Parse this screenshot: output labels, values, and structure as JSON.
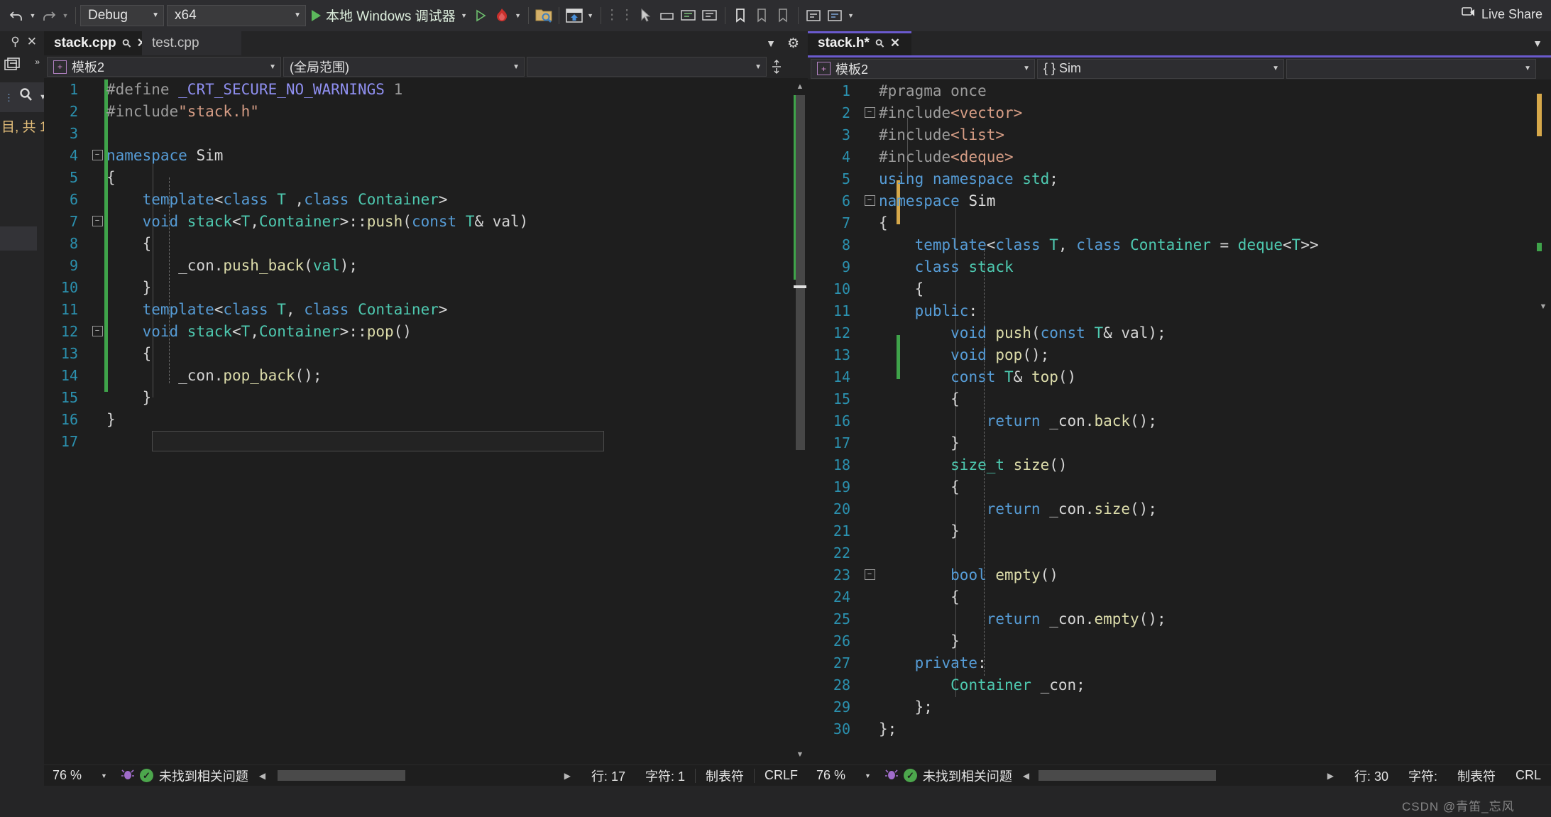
{
  "toolbar": {
    "undo_icon": "undo-icon",
    "redo_icon": "redo-icon",
    "config_value": "Debug",
    "platform_value": "x64",
    "run_label": "本地 Windows 调试器",
    "icons": [
      "folder-search-icon",
      "window-home-icon",
      "bookmark-icon",
      "bookmark-prev-icon",
      "bookmark-next-icon",
      "comment-icon",
      "uncomment-icon"
    ],
    "live_share_label": "Live Share"
  },
  "left_dock": {
    "pin_icon": "pin-icon",
    "close_icon": "close-icon",
    "window_icon": "window-restore-icon",
    "search_icon": "search-icon",
    "truncated_label": "目, 共 1"
  },
  "left_pane": {
    "tabs": [
      {
        "label": "stack.cpp",
        "active": true,
        "pin_icon": "pin-icon",
        "close_icon": "close-icon"
      },
      {
        "label": "test.cpp",
        "active": false,
        "pin_icon": "pin-icon",
        "close_icon": "close-icon"
      }
    ],
    "tabstrip_overflow_icon": "chevron-down-icon",
    "tabstrip_settings_icon": "gear-icon",
    "nav_project": "模板2",
    "nav_scope": "(全局范围)",
    "nav_member": "",
    "splitter_icon": "split-vertical-icon",
    "lines": [
      {
        "n": "1",
        "tokens": [
          {
            "t": "#define ",
            "c": "k-grey"
          },
          {
            "t": "_CRT_SECURE_NO_WARNINGS",
            "c": "k-purple"
          },
          {
            "t": " 1",
            "c": "k-grey"
          }
        ]
      },
      {
        "n": "2",
        "tokens": [
          {
            "t": "#include",
            "c": "k-grey"
          },
          {
            "t": "\"stack.h\"",
            "c": "k-orange"
          }
        ]
      },
      {
        "n": "3",
        "tokens": []
      },
      {
        "n": "4",
        "tokens": [
          {
            "t": "namespace ",
            "c": "k-blue"
          },
          {
            "t": "Sim",
            "c": "k-white"
          }
        ]
      },
      {
        "n": "5",
        "tokens": [
          {
            "t": "{",
            "c": "k-plain"
          }
        ]
      },
      {
        "n": "6",
        "tokens": [
          {
            "t": "    ",
            "c": "k-plain"
          },
          {
            "t": "template",
            "c": "k-blue"
          },
          {
            "t": "<",
            "c": "k-plain"
          },
          {
            "t": "class ",
            "c": "k-blue"
          },
          {
            "t": "T",
            "c": "k-cyan"
          },
          {
            "t": " ,",
            "c": "k-plain"
          },
          {
            "t": "class ",
            "c": "k-blue"
          },
          {
            "t": "Container",
            "c": "k-cyan"
          },
          {
            "t": ">",
            "c": "k-plain"
          }
        ]
      },
      {
        "n": "7",
        "tokens": [
          {
            "t": "    ",
            "c": "k-plain"
          },
          {
            "t": "void ",
            "c": "k-blue"
          },
          {
            "t": "stack",
            "c": "k-cyan"
          },
          {
            "t": "<",
            "c": "k-plain"
          },
          {
            "t": "T",
            "c": "k-cyan"
          },
          {
            "t": ",",
            "c": "k-plain"
          },
          {
            "t": "Container",
            "c": "k-cyan"
          },
          {
            "t": ">::",
            "c": "k-plain"
          },
          {
            "t": "push",
            "c": "k-yellow"
          },
          {
            "t": "(",
            "c": "k-plain"
          },
          {
            "t": "const ",
            "c": "k-blue"
          },
          {
            "t": "T",
            "c": "k-cyan"
          },
          {
            "t": "& val)",
            "c": "k-plain"
          }
        ]
      },
      {
        "n": "8",
        "tokens": [
          {
            "t": "    {",
            "c": "k-plain"
          }
        ]
      },
      {
        "n": "9",
        "tokens": [
          {
            "t": "        _con.",
            "c": "k-plain"
          },
          {
            "t": "push_back",
            "c": "k-yellow"
          },
          {
            "t": "(",
            "c": "k-plain"
          },
          {
            "t": "val",
            "c": "k-cyan"
          },
          {
            "t": ");",
            "c": "k-plain"
          }
        ]
      },
      {
        "n": "10",
        "tokens": [
          {
            "t": "    }",
            "c": "k-plain"
          }
        ]
      },
      {
        "n": "11",
        "tokens": [
          {
            "t": "    ",
            "c": "k-plain"
          },
          {
            "t": "template",
            "c": "k-blue"
          },
          {
            "t": "<",
            "c": "k-plain"
          },
          {
            "t": "class ",
            "c": "k-blue"
          },
          {
            "t": "T",
            "c": "k-cyan"
          },
          {
            "t": ", ",
            "c": "k-plain"
          },
          {
            "t": "class ",
            "c": "k-blue"
          },
          {
            "t": "Container",
            "c": "k-cyan"
          },
          {
            "t": ">",
            "c": "k-plain"
          }
        ]
      },
      {
        "n": "12",
        "tokens": [
          {
            "t": "    ",
            "c": "k-plain"
          },
          {
            "t": "void ",
            "c": "k-blue"
          },
          {
            "t": "stack",
            "c": "k-cyan"
          },
          {
            "t": "<",
            "c": "k-plain"
          },
          {
            "t": "T",
            "c": "k-cyan"
          },
          {
            "t": ",",
            "c": "k-plain"
          },
          {
            "t": "Container",
            "c": "k-cyan"
          },
          {
            "t": ">::",
            "c": "k-plain"
          },
          {
            "t": "pop",
            "c": "k-yellow"
          },
          {
            "t": "()",
            "c": "k-plain"
          }
        ]
      },
      {
        "n": "13",
        "tokens": [
          {
            "t": "    {",
            "c": "k-plain"
          }
        ]
      },
      {
        "n": "14",
        "tokens": [
          {
            "t": "        _con.",
            "c": "k-plain"
          },
          {
            "t": "pop_back",
            "c": "k-yellow"
          },
          {
            "t": "();",
            "c": "k-plain"
          }
        ]
      },
      {
        "n": "15",
        "tokens": [
          {
            "t": "    }",
            "c": "k-plain"
          }
        ]
      },
      {
        "n": "16",
        "tokens": [
          {
            "t": "}",
            "c": "k-plain"
          }
        ]
      },
      {
        "n": "17",
        "tokens": []
      }
    ],
    "status": {
      "zoom": "76 %",
      "zoom_caret_icon": "chevron-down-icon",
      "bug_icon": "bug-icon",
      "ok_icon": "check-icon",
      "issues": "未找到相关问题",
      "scroll_left_icon": "chevron-left-icon",
      "scroll_right_icon": "chevron-right-icon",
      "line": "行: 17",
      "column": "字符: 1",
      "indent": "制表符",
      "eol": "CRLF"
    }
  },
  "right_pane": {
    "tabs": [
      {
        "label": "stack.h*",
        "active": true,
        "pin_icon": "pin-icon",
        "close_icon": "close-icon",
        "accent": "#6a5acd"
      }
    ],
    "nav_project": "模板2",
    "nav_scope": "{ } Sim",
    "nav_member": "",
    "lines": [
      {
        "n": "1",
        "tokens": [
          {
            "t": "#pragma once",
            "c": "k-grey"
          }
        ]
      },
      {
        "n": "2",
        "tokens": [
          {
            "t": "#include",
            "c": "k-grey"
          },
          {
            "t": "<vector>",
            "c": "k-orange"
          }
        ]
      },
      {
        "n": "3",
        "tokens": [
          {
            "t": "#include",
            "c": "k-grey"
          },
          {
            "t": "<list>",
            "c": "k-orange"
          }
        ]
      },
      {
        "n": "4",
        "tokens": [
          {
            "t": "#include",
            "c": "k-grey"
          },
          {
            "t": "<deque>",
            "c": "k-orange"
          }
        ]
      },
      {
        "n": "5",
        "tokens": [
          {
            "t": "using namespace ",
            "c": "k-blue"
          },
          {
            "t": "std",
            "c": "k-cyan"
          },
          {
            "t": ";",
            "c": "k-plain"
          }
        ]
      },
      {
        "n": "6",
        "tokens": [
          {
            "t": "namespace ",
            "c": "k-blue"
          },
          {
            "t": "Sim",
            "c": "k-white"
          }
        ]
      },
      {
        "n": "7",
        "tokens": [
          {
            "t": "{",
            "c": "k-plain"
          }
        ]
      },
      {
        "n": "8",
        "tokens": [
          {
            "t": "    ",
            "c": "k-plain"
          },
          {
            "t": "template",
            "c": "k-blue"
          },
          {
            "t": "<",
            "c": "k-plain"
          },
          {
            "t": "class ",
            "c": "k-blue"
          },
          {
            "t": "T",
            "c": "k-cyan"
          },
          {
            "t": ", ",
            "c": "k-plain"
          },
          {
            "t": "class ",
            "c": "k-blue"
          },
          {
            "t": "Container",
            "c": "k-cyan"
          },
          {
            "t": " = ",
            "c": "k-plain"
          },
          {
            "t": "deque",
            "c": "k-cyan"
          },
          {
            "t": "<",
            "c": "k-plain"
          },
          {
            "t": "T",
            "c": "k-cyan"
          },
          {
            "t": ">>",
            "c": "k-plain"
          }
        ]
      },
      {
        "n": "9",
        "tokens": [
          {
            "t": "    ",
            "c": "k-plain"
          },
          {
            "t": "class ",
            "c": "k-blue"
          },
          {
            "t": "stack",
            "c": "k-cyan"
          }
        ]
      },
      {
        "n": "10",
        "tokens": [
          {
            "t": "    {",
            "c": "k-plain"
          }
        ]
      },
      {
        "n": "11",
        "tokens": [
          {
            "t": "    ",
            "c": "k-plain"
          },
          {
            "t": "public",
            "c": "k-blue"
          },
          {
            "t": ":",
            "c": "k-plain"
          }
        ]
      },
      {
        "n": "12",
        "tokens": [
          {
            "t": "        ",
            "c": "k-plain"
          },
          {
            "t": "void ",
            "c": "k-blue"
          },
          {
            "t": "push",
            "c": "k-yellow"
          },
          {
            "t": "(",
            "c": "k-plain"
          },
          {
            "t": "const ",
            "c": "k-blue"
          },
          {
            "t": "T",
            "c": "k-cyan"
          },
          {
            "t": "& val);",
            "c": "k-plain"
          }
        ]
      },
      {
        "n": "13",
        "tokens": [
          {
            "t": "        ",
            "c": "k-plain"
          },
          {
            "t": "void ",
            "c": "k-blue"
          },
          {
            "t": "pop",
            "c": "k-yellow"
          },
          {
            "t": "();",
            "c": "k-plain"
          }
        ]
      },
      {
        "n": "14",
        "tokens": [
          {
            "t": "        ",
            "c": "k-plain"
          },
          {
            "t": "const ",
            "c": "k-blue"
          },
          {
            "t": "T",
            "c": "k-cyan"
          },
          {
            "t": "& ",
            "c": "k-plain"
          },
          {
            "t": "top",
            "c": "k-yellow"
          },
          {
            "t": "()",
            "c": "k-plain"
          }
        ]
      },
      {
        "n": "15",
        "tokens": [
          {
            "t": "        {",
            "c": "k-plain"
          }
        ]
      },
      {
        "n": "16",
        "tokens": [
          {
            "t": "            ",
            "c": "k-plain"
          },
          {
            "t": "return ",
            "c": "k-blue"
          },
          {
            "t": "_con.",
            "c": "k-plain"
          },
          {
            "t": "back",
            "c": "k-yellow"
          },
          {
            "t": "();",
            "c": "k-plain"
          }
        ]
      },
      {
        "n": "17",
        "tokens": [
          {
            "t": "        }",
            "c": "k-plain"
          }
        ]
      },
      {
        "n": "18",
        "tokens": [
          {
            "t": "        ",
            "c": "k-plain"
          },
          {
            "t": "size_t ",
            "c": "k-cyan"
          },
          {
            "t": "size",
            "c": "k-yellow"
          },
          {
            "t": "()",
            "c": "k-plain"
          }
        ]
      },
      {
        "n": "19",
        "tokens": [
          {
            "t": "        {",
            "c": "k-plain"
          }
        ]
      },
      {
        "n": "20",
        "tokens": [
          {
            "t": "            ",
            "c": "k-plain"
          },
          {
            "t": "return ",
            "c": "k-blue"
          },
          {
            "t": "_con.",
            "c": "k-plain"
          },
          {
            "t": "size",
            "c": "k-yellow"
          },
          {
            "t": "();",
            "c": "k-plain"
          }
        ]
      },
      {
        "n": "21",
        "tokens": [
          {
            "t": "        }",
            "c": "k-plain"
          }
        ]
      },
      {
        "n": "22",
        "tokens": []
      },
      {
        "n": "23",
        "tokens": [
          {
            "t": "        ",
            "c": "k-plain"
          },
          {
            "t": "bool ",
            "c": "k-blue"
          },
          {
            "t": "empty",
            "c": "k-yellow"
          },
          {
            "t": "()",
            "c": "k-plain"
          }
        ]
      },
      {
        "n": "24",
        "tokens": [
          {
            "t": "        {",
            "c": "k-plain"
          }
        ]
      },
      {
        "n": "25",
        "tokens": [
          {
            "t": "            ",
            "c": "k-plain"
          },
          {
            "t": "return ",
            "c": "k-blue"
          },
          {
            "t": "_con.",
            "c": "k-plain"
          },
          {
            "t": "empty",
            "c": "k-yellow"
          },
          {
            "t": "();",
            "c": "k-plain"
          }
        ]
      },
      {
        "n": "26",
        "tokens": [
          {
            "t": "        }",
            "c": "k-plain"
          }
        ]
      },
      {
        "n": "27",
        "tokens": [
          {
            "t": "    ",
            "c": "k-plain"
          },
          {
            "t": "private",
            "c": "k-blue"
          },
          {
            "t": ":",
            "c": "k-plain"
          }
        ]
      },
      {
        "n": "28",
        "tokens": [
          {
            "t": "        ",
            "c": "k-plain"
          },
          {
            "t": "Container",
            "c": "k-cyan"
          },
          {
            "t": " _con;",
            "c": "k-plain"
          }
        ]
      },
      {
        "n": "29",
        "tokens": [
          {
            "t": "    };",
            "c": "k-plain"
          }
        ]
      },
      {
        "n": "30",
        "tokens": [
          {
            "t": "};",
            "c": "k-plain"
          }
        ]
      }
    ],
    "status": {
      "zoom": "76 %",
      "zoom_caret_icon": "chevron-down-icon",
      "bug_icon": "bug-icon",
      "ok_icon": "check-icon",
      "issues": "未找到相关问题",
      "scroll_left_icon": "chevron-left-icon",
      "scroll_right_icon": "chevron-right-icon",
      "line": "行: 30",
      "column": "字符:",
      "indent": "制表符",
      "eol": "CRL"
    }
  },
  "watermark": {
    "text": "CSDN @青笛_忘风"
  },
  "colors": {
    "accent_tab": "#6a5acd",
    "change_saved": "#3fa34a",
    "change_unsaved": "#d6a84a",
    "ok_green": "#4ca64c",
    "linenum": "#2b91af"
  }
}
